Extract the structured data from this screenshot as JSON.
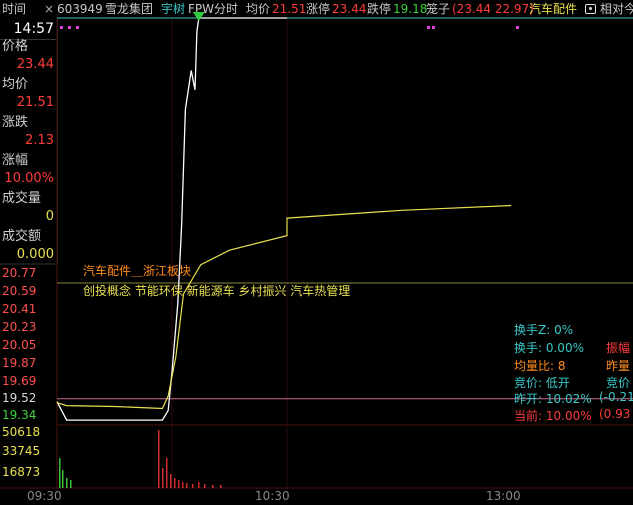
{
  "topbar": {
    "tab_label": "时间",
    "close_symbol": "×",
    "stock_code": "603949",
    "stock_name": "雪龙集团",
    "brand": "宇树",
    "mode": "FPW分时",
    "avg_label": "均价",
    "avg_value": "21.51",
    "limit_up_label": "涨停",
    "limit_up_value": "23.44",
    "limit_down_label": "跌停",
    "limit_down_value": "19.18",
    "cage_label": "笼子",
    "cage_value": "(23.44 22.97)",
    "sector": "汽车配件",
    "camera_icon": "camera-icon",
    "relative_label": "相对今"
  },
  "sidebar": {
    "time": "14:57",
    "price_label": "价格",
    "price_value": "23.44",
    "avg_label": "均价",
    "avg_value": "21.51",
    "change_label": "涨跌",
    "change_value": "2.13",
    "pct_label": "涨幅",
    "pct_value": "10.00%",
    "volume_label": "成交量",
    "volume_value": "0",
    "amount_label": "成交额",
    "amount_value": "0.000"
  },
  "price_axis": [
    "20.77",
    "20.59",
    "20.41",
    "20.23",
    "20.05",
    "19.87",
    "19.69",
    "19.52",
    "19.34"
  ],
  "volume_axis": [
    "50618",
    "33745",
    "16873"
  ],
  "time_axis": [
    "09:30",
    "10:30",
    "13:00"
  ],
  "annotations": {
    "sector_board": "汽车配件＿浙江板块",
    "concepts": "创投概念 节能环保 新能源车 乡村振兴 汽车热管理"
  },
  "stats": {
    "turnover_z": "换手Z: 0%",
    "turnover": "换手: 0.00%",
    "amplitude": "振幅",
    "vol_ratio": "均量比: 8",
    "prev_ratio": "昨量",
    "auction": "竞价: 低开",
    "auction2": "竞价",
    "yesterday_open": "昨开: 10.02%",
    "yesterday_open_val": "(-0.21",
    "current": "当前: 10.00%",
    "current_val": "(0.93"
  },
  "colors": {
    "up": "#ff3c3c",
    "price_line": "#ffffff",
    "avg_line": "#e8e050",
    "limit_line": "#3fbfbf",
    "cyan_text": "#3ac7c7",
    "orange": "#ff8c1a",
    "volume_bar": "#d02c2c"
  },
  "chart_data": {
    "type": "line",
    "series": [
      {
        "values_time": [
          "09:30",
          "09:35",
          "09:40",
          "09:50",
          "10:00",
          "10:20",
          "10:25",
          "10:28",
          "10:30",
          "10:33",
          "10:35",
          "10:37",
          "10:40",
          "10:42",
          "10:43",
          "10:44"
        ],
        "values": [
          19.49,
          19.3,
          19.3,
          19.3,
          19.3,
          19.3,
          19.3,
          19.4,
          19.8,
          20.5,
          21.3,
          22.5,
          22.9,
          22.7,
          23.3,
          23.44
        ]
      },
      {
        "values_time": [
          "09:30",
          "09:35",
          "10:00",
          "10:25",
          "10:28",
          "10:32",
          "10:36",
          "10:45",
          "11:00",
          "11:30",
          "13:00",
          "14:00",
          "14:57"
        ],
        "values": [
          19.48,
          19.45,
          19.44,
          19.42,
          19.55,
          19.95,
          20.6,
          20.9,
          21.05,
          21.2,
          21.38,
          21.46,
          21.51
        ]
      }
    ],
    "limit_up": 23.44,
    "prev_close": 19.52,
    "ylim": [
      19.25,
      23.44
    ]
  }
}
